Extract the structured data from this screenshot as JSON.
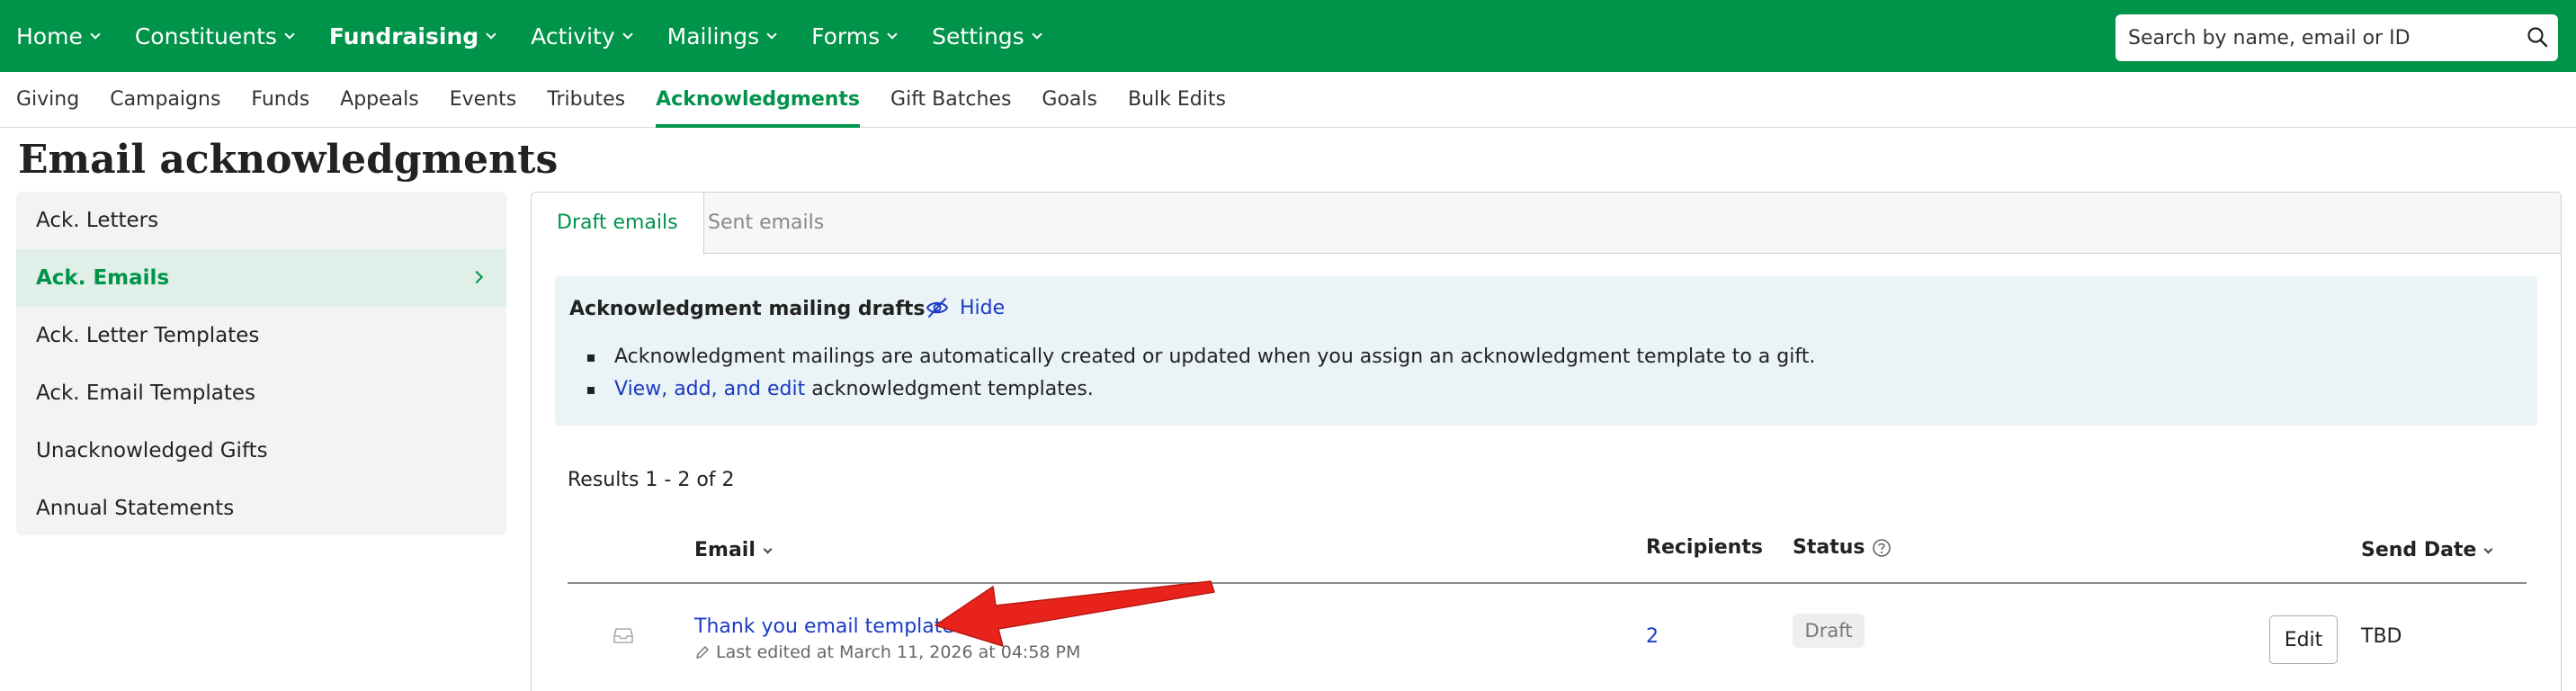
{
  "nav": {
    "items": [
      {
        "label": "Home",
        "active": false
      },
      {
        "label": "Constituents",
        "active": false
      },
      {
        "label": "Fundraising",
        "active": true
      },
      {
        "label": "Activity",
        "active": false
      },
      {
        "label": "Mailings",
        "active": false
      },
      {
        "label": "Forms",
        "active": false
      },
      {
        "label": "Settings",
        "active": false
      }
    ],
    "search_placeholder": "Search by name, email or ID",
    "color": "#00934a"
  },
  "subnav": {
    "items": [
      {
        "label": "Giving"
      },
      {
        "label": "Campaigns"
      },
      {
        "label": "Funds"
      },
      {
        "label": "Appeals"
      },
      {
        "label": "Events"
      },
      {
        "label": "Tributes"
      },
      {
        "label": "Acknowledgments",
        "active": true
      },
      {
        "label": "Gift Batches"
      },
      {
        "label": "Goals"
      },
      {
        "label": "Bulk Edits"
      }
    ]
  },
  "page": {
    "title": "Email acknowledgments"
  },
  "sidebar": {
    "items": [
      {
        "label": "Ack. Letters"
      },
      {
        "label": "Ack. Emails",
        "active": true
      },
      {
        "label": "Ack. Letter Templates"
      },
      {
        "label": "Ack. Email Templates"
      },
      {
        "label": "Unacknowledged Gifts"
      },
      {
        "label": "Annual Statements"
      }
    ]
  },
  "panel": {
    "tabs": [
      {
        "label": "Draft emails",
        "active": true
      },
      {
        "label": "Sent emails",
        "active": false
      }
    ],
    "info": {
      "title": "Acknowledgment mailing drafts",
      "hide_label": "Hide",
      "bullet1": "Acknowledgment mailings are automatically created or updated when you assign an acknowledgment template to a gift.",
      "bullet2_link": "View, add, and edit",
      "bullet2_rest": " acknowledgment templates."
    },
    "results_text": "Results 1 - 2 of 2",
    "table": {
      "headers": {
        "email": "Email",
        "recipients": "Recipients",
        "status": "Status",
        "send_date": "Send Date"
      },
      "rows": [
        {
          "title": "Thank you email template",
          "meta": "Last edited at March 11, 2026 at 04:58 PM",
          "recipients": "2",
          "status": "Draft",
          "edit_label": "Edit",
          "send_date": "TBD"
        }
      ]
    }
  },
  "annotation": {
    "arrow_color": "#e8231c"
  }
}
